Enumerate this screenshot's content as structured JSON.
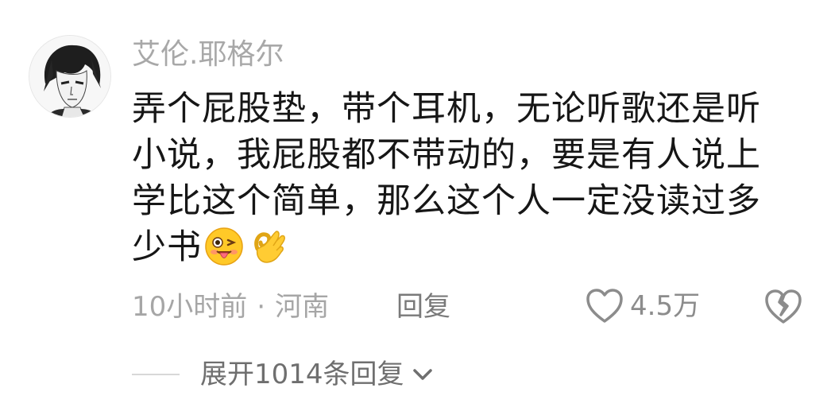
{
  "comment": {
    "username": "艾伦.耶格尔",
    "avatar_icon": "anime-character-avatar",
    "text": "弄个屁股垫，带个耳机，无论听歌还是听小说，我屁股都不带动的，要是有人说上学比这个简单，那么这个人一定没读过多少书",
    "emojis": [
      "tongue-wink-emoji",
      "ok-hand-emoji"
    ],
    "time": "10小时前",
    "separator": "·",
    "location": "河南",
    "reply_label": "回复",
    "like_count": "4.5万",
    "expand_label": "展开1014条回复"
  },
  "colors": {
    "username": "#a8a8a8",
    "body_text": "#161616",
    "meta_text": "#a6a6a6",
    "icon_gray": "#8c8c8c"
  }
}
